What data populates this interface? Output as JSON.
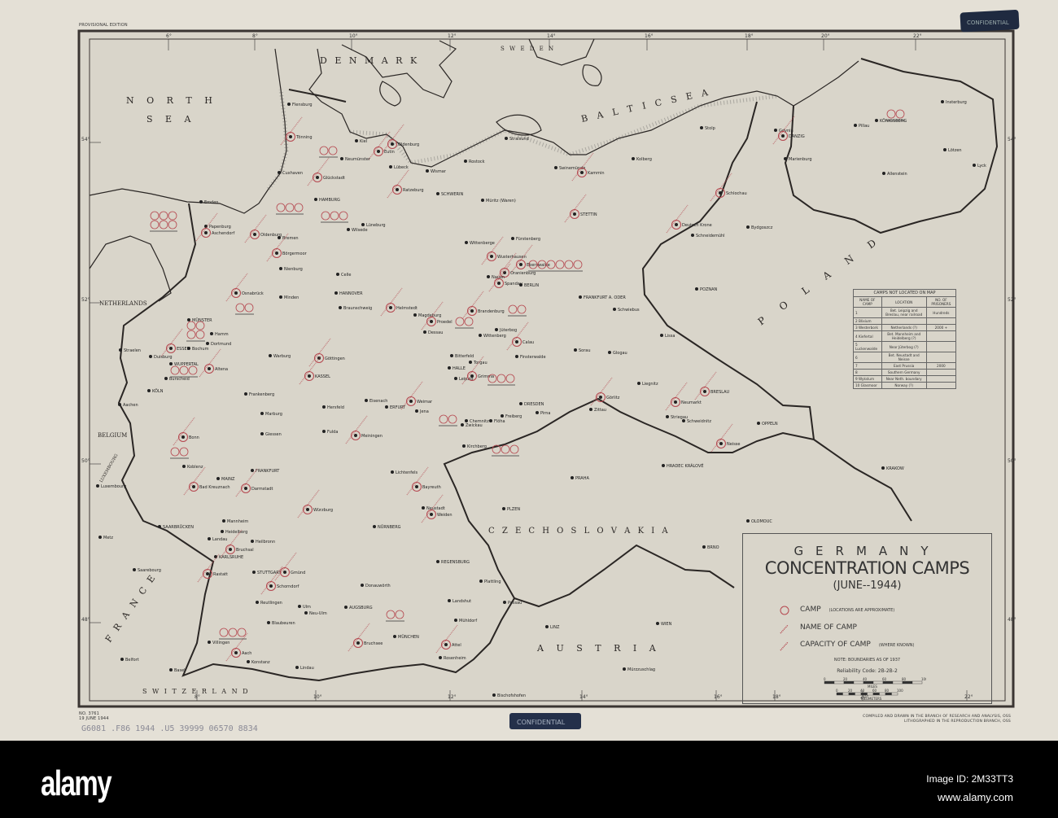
{
  "header": {
    "edition": "PROVISIONAL EDITION",
    "stamp_top": "CONFIDENTIAL"
  },
  "regions": {
    "north_sea_1": "N O R T H",
    "north_sea_2": "S E A",
    "denmark": "D E N M A R K",
    "sweden": "S W E D E N",
    "baltic": "B  A  L  T  I  C     S  E  A",
    "netherlands": "NETHERLANDS",
    "belgium": "BELGIUM",
    "luxembourg": "LUXEMBOURG",
    "france": "F  R  A  N  C  E",
    "switzerland": "S W I T Z E R L A N D",
    "czechoslovakia": "C Z E C H O S L O V A K I A",
    "austria": "A  U  S  T  R  I  A",
    "poland": "P  O  L  A  N  D"
  },
  "graticule": {
    "top": [
      "6°",
      "8°",
      "10°",
      "12°",
      "14°",
      "16°",
      "18°",
      "20°",
      "22°"
    ],
    "bottom": [
      "8°",
      "10°",
      "12°",
      "14°",
      "16°",
      "18°",
      "20°",
      "22°"
    ],
    "left": [
      "54°",
      "52°",
      "50°",
      "48°"
    ]
  },
  "cities": [
    {
      "name": "Flensburg",
      "camp": false
    },
    {
      "name": "Tönning",
      "camp": true
    },
    {
      "name": "Kiel",
      "camp": false
    },
    {
      "name": "Oldenburg",
      "camp": true
    },
    {
      "name": "Eutin",
      "camp": true
    },
    {
      "name": "Neumünster",
      "camp": false
    },
    {
      "name": "Cuxhaven",
      "camp": false
    },
    {
      "name": "Glückstadt",
      "camp": true
    },
    {
      "name": "Lübeck",
      "camp": false
    },
    {
      "name": "Wismar",
      "camp": false
    },
    {
      "name": "Rostock",
      "camp": false
    },
    {
      "name": "Stralsund",
      "camp": false
    },
    {
      "name": "Ratzeburg",
      "camp": true
    },
    {
      "name": "SCHWERIN",
      "camp": false
    },
    {
      "name": "HAMBURG",
      "camp": false
    },
    {
      "name": "Emden",
      "camp": false
    },
    {
      "name": "Papenburg",
      "camp": false
    },
    {
      "name": "Aschendorf",
      "camp": true
    },
    {
      "name": "Oldenburg",
      "camp": true
    },
    {
      "name": "Bremen",
      "camp": false
    },
    {
      "name": "Wilsede",
      "camp": false
    },
    {
      "name": "Lüneburg",
      "camp": false
    },
    {
      "name": "Müritz (Waren)",
      "camp": false
    },
    {
      "name": "Fürstenberg",
      "camp": false
    },
    {
      "name": "STETTIN",
      "camp": true
    },
    {
      "name": "Swinemünde",
      "camp": false
    },
    {
      "name": "Kammin",
      "camp": true
    },
    {
      "name": "Kolberg",
      "camp": false
    },
    {
      "name": "Stolp",
      "camp": false
    },
    {
      "name": "Gdynia",
      "camp": false
    },
    {
      "name": "DANZIG",
      "camp": true
    },
    {
      "name": "KÖNIGSBERG",
      "camp": false
    },
    {
      "name": "Pillau",
      "camp": false
    },
    {
      "name": "Insterburg",
      "camp": false
    },
    {
      "name": "Marienburg",
      "camp": false
    },
    {
      "name": "Lötzen",
      "camp": false
    },
    {
      "name": "Allenstein",
      "camp": false
    },
    {
      "name": "Lyck",
      "camp": false
    },
    {
      "name": "Schlochau",
      "camp": true
    },
    {
      "name": "Deutsch Krone",
      "camp": true
    },
    {
      "name": "Schneidemühl",
      "camp": false
    },
    {
      "name": "Bydgoszcz",
      "camp": false
    },
    {
      "name": "Wittenberge",
      "camp": false
    },
    {
      "name": "Börgermoor",
      "camp": true
    },
    {
      "name": "Nienburg",
      "camp": false
    },
    {
      "name": "Wusterhausen",
      "camp": true
    },
    {
      "name": "Eberswalde",
      "camp": true
    },
    {
      "name": "Oranienburg",
      "camp": true
    },
    {
      "name": "Nauen",
      "camp": false
    },
    {
      "name": "Spandau",
      "camp": true
    },
    {
      "name": "BERLIN",
      "camp": false
    },
    {
      "name": "Celle",
      "camp": false
    },
    {
      "name": "Osnabrück",
      "camp": true
    },
    {
      "name": "Minden",
      "camp": false
    },
    {
      "name": "HANNOVER",
      "camp": false
    },
    {
      "name": "Braunschweig",
      "camp": false
    },
    {
      "name": "Helmstedt",
      "camp": true
    },
    {
      "name": "Magdeburg",
      "camp": false
    },
    {
      "name": "Brandenburg",
      "camp": true
    },
    {
      "name": "FRANKFURT A. ODER",
      "camp": false
    },
    {
      "name": "POZNAN",
      "camp": false
    },
    {
      "name": "Schwiebus",
      "camp": false
    },
    {
      "name": "MÜNSTER",
      "camp": false
    },
    {
      "name": "Hamm",
      "camp": false
    },
    {
      "name": "Dortmund",
      "camp": false
    },
    {
      "name": "Bochum",
      "camp": false
    },
    {
      "name": "ESSEN",
      "camp": true
    },
    {
      "name": "Duisburg",
      "camp": false
    },
    {
      "name": "Straelen",
      "camp": false
    },
    {
      "name": "WUPPERTAL",
      "camp": false
    },
    {
      "name": "Altena",
      "camp": true
    },
    {
      "name": "Burscheid",
      "camp": false
    },
    {
      "name": "KÖLN",
      "camp": false
    },
    {
      "name": "Aachen",
      "camp": false
    },
    {
      "name": "Proedel",
      "camp": true
    },
    {
      "name": "Dessau",
      "camp": false
    },
    {
      "name": "Wittenberg",
      "camp": false
    },
    {
      "name": "Jüterbog",
      "camp": false
    },
    {
      "name": "Bitterfeld",
      "camp": false
    },
    {
      "name": "Torgau",
      "camp": false
    },
    {
      "name": "HALLE",
      "camp": false
    },
    {
      "name": "Leipzig",
      "camp": false
    },
    {
      "name": "Grimma",
      "camp": true
    },
    {
      "name": "Calau",
      "camp": true
    },
    {
      "name": "Finsterwalde",
      "camp": false
    },
    {
      "name": "Sorau",
      "camp": false
    },
    {
      "name": "Glogau",
      "camp": false
    },
    {
      "name": "Lissa",
      "camp": false
    },
    {
      "name": "Warburg",
      "camp": false
    },
    {
      "name": "Göttingen",
      "camp": true
    },
    {
      "name": "KASSEL",
      "camp": true
    },
    {
      "name": "Frankenberg",
      "camp": false
    },
    {
      "name": "Marburg",
      "camp": false
    },
    {
      "name": "Hersfeld",
      "camp": false
    },
    {
      "name": "Eisenach",
      "camp": false
    },
    {
      "name": "ERFURT",
      "camp": false
    },
    {
      "name": "Weimar",
      "camp": true
    },
    {
      "name": "Jena",
      "camp": false
    },
    {
      "name": "Chemnitz",
      "camp": false
    },
    {
      "name": "Zwickau",
      "camp": false
    },
    {
      "name": "Flöha",
      "camp": false
    },
    {
      "name": "Freiberg",
      "camp": false
    },
    {
      "name": "DRESDEN",
      "camp": false
    },
    {
      "name": "Pirna",
      "camp": false
    },
    {
      "name": "Görlitz",
      "camp": true
    },
    {
      "name": "Zittau",
      "camp": false
    },
    {
      "name": "Liegnitz",
      "camp": false
    },
    {
      "name": "Neumarkt",
      "camp": true
    },
    {
      "name": "BRESLAU",
      "camp": true
    },
    {
      "name": "Striegau",
      "camp": false
    },
    {
      "name": "Schweidnitz",
      "camp": false
    },
    {
      "name": "OPPELN",
      "camp": false
    },
    {
      "name": "Neisse",
      "camp": true
    },
    {
      "name": "Kirchberg",
      "camp": false
    },
    {
      "name": "Bonn",
      "camp": true
    },
    {
      "name": "Giessen",
      "camp": false
    },
    {
      "name": "Fulda",
      "camp": false
    },
    {
      "name": "Meiningen",
      "camp": true
    },
    {
      "name": "Koblenz",
      "camp": false
    },
    {
      "name": "FRANKFURT",
      "camp": false
    },
    {
      "name": "MAINZ",
      "camp": false
    },
    {
      "name": "Darmstadt",
      "camp": true
    },
    {
      "name": "Bad Kreuznach",
      "camp": true
    },
    {
      "name": "Lichtenfels",
      "camp": false
    },
    {
      "name": "Bayreuth",
      "camp": true
    },
    {
      "name": "Luxembourg",
      "camp": false
    },
    {
      "name": "Würzburg",
      "camp": true
    },
    {
      "name": "Neustadt",
      "camp": false
    },
    {
      "name": "Weiden",
      "camp": true
    },
    {
      "name": "PLZEN",
      "camp": false
    },
    {
      "name": "PRAHA",
      "camp": false
    },
    {
      "name": "HRADEC KRÁLOVÉ",
      "camp": false
    },
    {
      "name": "KRAKOW",
      "camp": false
    },
    {
      "name": "OLOMOUC",
      "camp": false
    },
    {
      "name": "BRNO",
      "camp": false
    },
    {
      "name": "Metz",
      "camp": false
    },
    {
      "name": "SAARBRÜCKEN",
      "camp": false
    },
    {
      "name": "Mannheim",
      "camp": false
    },
    {
      "name": "Heidelberg",
      "camp": false
    },
    {
      "name": "Landau",
      "camp": false
    },
    {
      "name": "Bruchsal",
      "camp": true
    },
    {
      "name": "KARLSRUHE",
      "camp": false
    },
    {
      "name": "Heilbronn",
      "camp": false
    },
    {
      "name": "NÜRNBERG",
      "camp": false
    },
    {
      "name": "REGENSBURG",
      "camp": false
    },
    {
      "name": "Saarebourg",
      "camp": false
    },
    {
      "name": "Rastatt",
      "camp": true
    },
    {
      "name": "STUTTGART",
      "camp": false
    },
    {
      "name": "Gmünd",
      "camp": true
    },
    {
      "name": "Schorndorf",
      "camp": true
    },
    {
      "name": "Donauwörth",
      "camp": false
    },
    {
      "name": "Plattling",
      "camp": false
    },
    {
      "name": "Passau",
      "camp": false
    },
    {
      "name": "Landshut",
      "camp": false
    },
    {
      "name": "Reutlingen",
      "camp": false
    },
    {
      "name": "Ulm",
      "camp": false
    },
    {
      "name": "Neu-Ulm",
      "camp": false
    },
    {
      "name": "Blaubeuren",
      "camp": false
    },
    {
      "name": "AUGSBURG",
      "camp": false
    },
    {
      "name": "MÜNCHEN",
      "camp": false
    },
    {
      "name": "Mühldorf",
      "camp": false
    },
    {
      "name": "Villingen",
      "camp": false
    },
    {
      "name": "Bruchsee",
      "camp": true
    },
    {
      "name": "LINZ",
      "camp": false
    },
    {
      "name": "WIEN",
      "camp": false
    },
    {
      "name": "Attel",
      "camp": true
    },
    {
      "name": "Rosenheim",
      "camp": false
    },
    {
      "name": "Belfort",
      "camp": false
    },
    {
      "name": "Aach",
      "camp": true
    },
    {
      "name": "Konstanz",
      "camp": false
    },
    {
      "name": "Lindau",
      "camp": false
    },
    {
      "name": "Basel",
      "camp": false
    },
    {
      "name": "Mürzzuschlag",
      "camp": false
    },
    {
      "name": "Bischofshofen",
      "camp": false
    }
  ],
  "camps_table": {
    "title": "CAMPS NOT LOCATED ON MAP",
    "columns": [
      "NAME OF CAMP",
      "LOCATION",
      "NO. OF PRISONERS"
    ],
    "rows": [
      [
        "1",
        "Bet. Leipzig and Breslau, near railroad",
        "Hundreds"
      ],
      [
        "2 Blixium",
        "",
        ""
      ],
      [
        "3 Westerbork",
        "Netherlands (?)",
        "2000 +"
      ],
      [
        "4 Kiefertal",
        "Bet. Mannheim and Heidelberg (?)",
        ""
      ],
      [
        "5 Luckenwalde",
        "Near Jüterbog (?)",
        ""
      ],
      [
        "6",
        "Bet. Neustadt and Neisse",
        ""
      ],
      [
        "7",
        "East Prussia",
        "2000"
      ],
      [
        "8",
        "Southern Germany",
        ""
      ],
      [
        "9 Wykslum",
        "Near Neth. boundary",
        ""
      ],
      [
        "10 Glasmoor",
        "Norway (?)",
        ""
      ]
    ]
  },
  "legend": {
    "country": "GERMANY",
    "title": "CONCENTRATION CAMPS",
    "date": "(JUNE--1944)",
    "camp": "CAMP",
    "camp_note": "(LOCATIONS ARE APPROXIMATE)",
    "name": "NAME OF CAMP",
    "capacity": "CAPACITY OF CAMP",
    "capacity_note": "(WHERE KNOWN)",
    "note": "NOTE: BOUNDARIES AS OF 1937",
    "reliability": "Reliability Code: 2B-2B-2",
    "miles_label": "MILES",
    "km_label": "KILOMETERS",
    "miles_ticks": [
      "0",
      "20",
      "40",
      "60",
      "80",
      "100"
    ],
    "km_ticks": [
      "0",
      "20",
      "40",
      "60",
      "80",
      "100"
    ]
  },
  "footer": {
    "map_no": "NO. 3761",
    "map_date": "19 JUNE 1944",
    "handwritten": "G6081 .F86 1944 .U5   39999 06570 8834",
    "stamp": "CONFIDENTIAL",
    "credit_1": "COMPILED AND DRAWN IN THE BRANCH OF RESEARCH AND ANALYSIS, OSS",
    "credit_2": "LITHOGRAPHED IN THE REPRODUCTION BRANCH, OSS"
  },
  "watermark": {
    "brand": "alamy",
    "image_id": "Image ID: 2M33TT3",
    "url": "www.alamy.com"
  },
  "colors": {
    "paper": "#d8d4c8",
    "ink": "#2a2624",
    "camp_red": "#b5474f"
  }
}
